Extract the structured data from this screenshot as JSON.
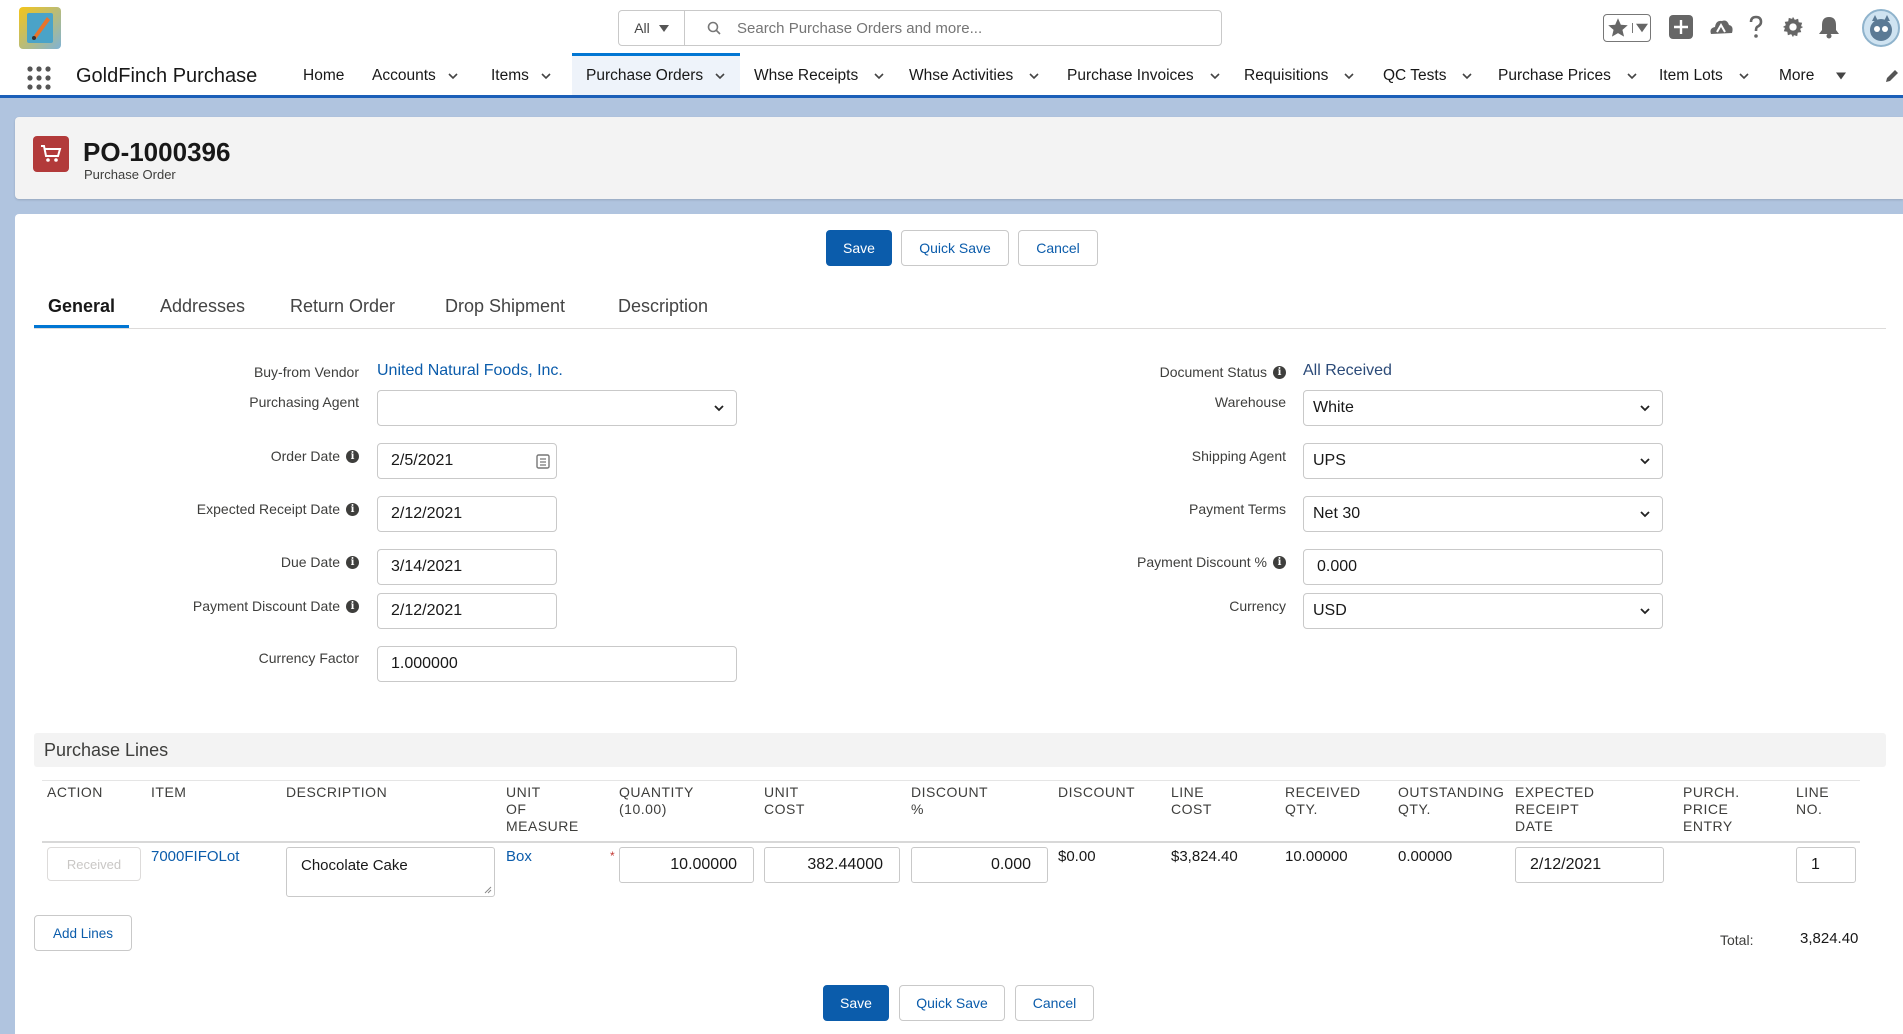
{
  "global_header": {
    "search_scope": "All",
    "search_placeholder": "Search Purchase Orders and more...",
    "icons": [
      "favorites-star-icon",
      "add-icon",
      "trailhead-icon",
      "help-icon",
      "setup-gear-icon",
      "notifications-bell-icon",
      "avatar"
    ]
  },
  "app": {
    "name": "GoldFinch Purchase",
    "nav": [
      {
        "label": "Home",
        "dropdown": false
      },
      {
        "label": "Accounts",
        "dropdown": true
      },
      {
        "label": "Items",
        "dropdown": true
      },
      {
        "label": "Purchase Orders",
        "dropdown": true,
        "active": true
      },
      {
        "label": "Whse Receipts",
        "dropdown": true
      },
      {
        "label": "Whse Activities",
        "dropdown": true
      },
      {
        "label": "Purchase Invoices",
        "dropdown": true
      },
      {
        "label": "Requisitions",
        "dropdown": true
      },
      {
        "label": "QC Tests",
        "dropdown": true
      },
      {
        "label": "Purchase Prices",
        "dropdown": true
      },
      {
        "label": "Item Lots",
        "dropdown": true
      },
      {
        "label": "More",
        "dropdown": true
      }
    ]
  },
  "record": {
    "title": "PO-1000396",
    "object_type": "Purchase Order"
  },
  "buttons": {
    "save": "Save",
    "quick_save": "Quick Save",
    "cancel": "Cancel"
  },
  "tabs": [
    "General",
    "Addresses",
    "Return Order",
    "Drop Shipment",
    "Description"
  ],
  "form_left": {
    "buy_from_vendor": {
      "label": "Buy-from Vendor",
      "value": "United Natural Foods, Inc."
    },
    "purchasing_agent": {
      "label": "Purchasing Agent",
      "value": ""
    },
    "order_date": {
      "label": "Order Date",
      "value": "2/5/2021"
    },
    "expected_receipt_date": {
      "label": "Expected Receipt Date",
      "value": "2/12/2021"
    },
    "due_date": {
      "label": "Due Date",
      "value": "3/14/2021"
    },
    "payment_discount_date": {
      "label": "Payment Discount Date",
      "value": "2/12/2021"
    },
    "currency_factor": {
      "label": "Currency Factor",
      "value": "1.000000"
    }
  },
  "form_right": {
    "document_status": {
      "label": "Document Status",
      "value": "All Received"
    },
    "warehouse": {
      "label": "Warehouse",
      "value": "White"
    },
    "shipping_agent": {
      "label": "Shipping Agent",
      "value": "UPS"
    },
    "payment_terms": {
      "label": "Payment Terms",
      "value": "Net 30"
    },
    "payment_discount_pct": {
      "label": "Payment Discount %",
      "value": "0.000"
    },
    "currency": {
      "label": "Currency",
      "value": "USD"
    }
  },
  "purchase_lines": {
    "title": "Purchase Lines",
    "columns": {
      "action": "ACTION",
      "item": "ITEM",
      "description": "DESCRIPTION",
      "uom": [
        "UNIT",
        "OF",
        "MEASURE"
      ],
      "quantity": [
        "QUANTITY",
        "(10.00)"
      ],
      "unit_cost": [
        "UNIT",
        "COST"
      ],
      "discount_pct": [
        "DISCOUNT",
        "%"
      ],
      "discount": "DISCOUNT",
      "line_cost": [
        "LINE",
        "COST"
      ],
      "received_qty": [
        "RECEIVED",
        "QTY."
      ],
      "outstanding_qty": [
        "OUTSTANDING",
        "QTY."
      ],
      "expected_receipt_date": [
        "EXPECTED",
        "RECEIPT",
        "DATE"
      ],
      "purch_price_entry": [
        "PURCH.",
        "PRICE",
        "ENTRY"
      ],
      "line_no": [
        "LINE",
        "NO."
      ]
    },
    "rows": [
      {
        "action": "Received",
        "item": "7000FIFOLot",
        "description": "Chocolate Cake",
        "uom": "Box",
        "required_mark": "*",
        "quantity": "10.00000",
        "unit_cost": "382.44000",
        "discount_pct": "0.000",
        "discount": "$0.00",
        "line_cost": "$3,824.40",
        "received_qty": "10.00000",
        "outstanding_qty": "0.00000",
        "expected_receipt_date": "2/12/2021",
        "purch_price_entry": "",
        "line_no": "1"
      }
    ],
    "add_lines": "Add Lines",
    "total_label": "Total:",
    "total_value": "3,824.40"
  },
  "colors": {
    "brand": "#0b5cab",
    "page_bg": "#b0c4df",
    "record_icon": "#b23a3a",
    "nav_active": "#0176d3"
  }
}
